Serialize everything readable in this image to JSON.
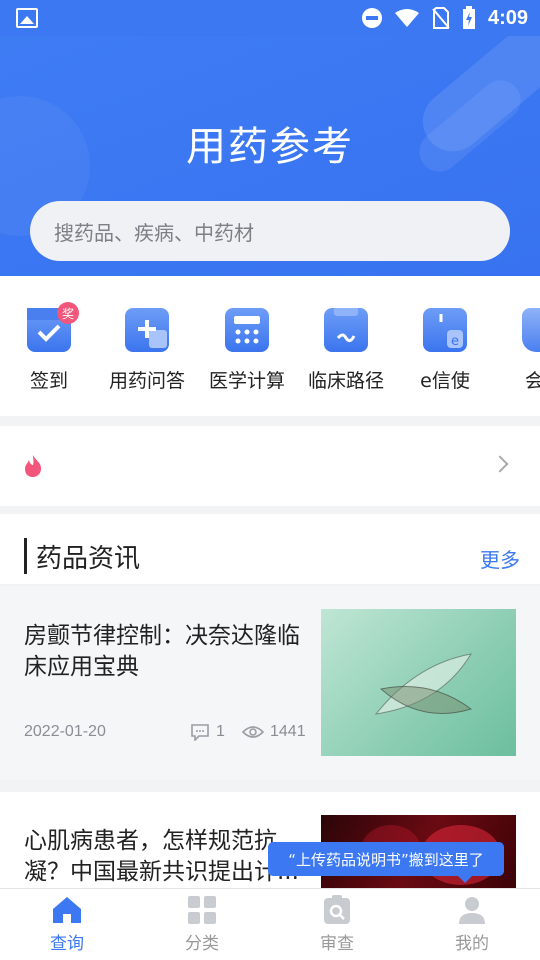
{
  "status_bar": {
    "time": "4:09"
  },
  "header": {
    "title": "用药参考",
    "search_placeholder": "搜药品、疾病、中药材"
  },
  "quick_actions": [
    {
      "label": "签到",
      "icon": "calendar-check-icon",
      "badge": "奖"
    },
    {
      "label": "用药问答",
      "icon": "chat-plus-icon"
    },
    {
      "label": "医学计算",
      "icon": "calculator-icon"
    },
    {
      "label": "临床路径",
      "icon": "clipboard-icon"
    },
    {
      "label": "e信使",
      "icon": "phone-e-icon"
    },
    {
      "label": "会员",
      "icon": "crown-icon"
    }
  ],
  "news_section": {
    "title": "药品资讯",
    "more": "更多"
  },
  "articles": [
    {
      "title": "房颤节律控制：决奈达隆临床应用宝典",
      "date": "2022-01-20",
      "comments": "1",
      "views": "1441"
    },
    {
      "title": "心肌病患者，怎样规范抗凝？中国最新共识提出计..."
    }
  ],
  "tooltip": {
    "text": "“上传药品说明书”搬到这里了"
  },
  "tab_bar": [
    {
      "label": "查询",
      "icon": "home-icon",
      "active": true
    },
    {
      "label": "分类",
      "icon": "grid-icon",
      "active": false
    },
    {
      "label": "审查",
      "icon": "search-doc-icon",
      "active": false
    },
    {
      "label": "我的",
      "icon": "user-icon",
      "active": false
    }
  ],
  "colors": {
    "primary": "#3b78f2",
    "badge": "#f2567a",
    "flame": "#f2567a"
  }
}
